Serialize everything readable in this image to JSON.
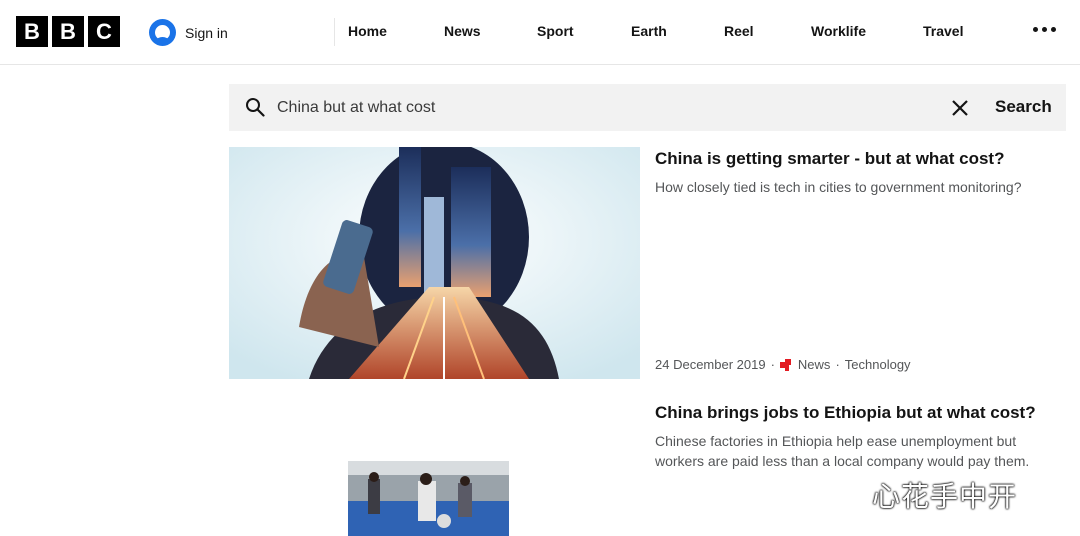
{
  "header": {
    "logo_letters": [
      "B",
      "B",
      "C"
    ],
    "signin_label": "Sign in",
    "nav": [
      "Home",
      "News",
      "Sport",
      "Earth",
      "Reel",
      "Worklife",
      "Travel"
    ],
    "more_icon": "more-horizontal-icon"
  },
  "search": {
    "value": "China but at what cost",
    "search_label": "Search",
    "search_icon": "search-icon",
    "clear_icon": "close-icon"
  },
  "results": [
    {
      "title": "China is getting smarter - but at what cost?",
      "summary": "How closely tied is tech in cities to government monitoring?",
      "date": "24 December 2019",
      "section": "News",
      "topic": "Technology",
      "separator": "·"
    },
    {
      "title": "China brings jobs to Ethiopia but at what cost?",
      "summary": "Chinese factories in Ethiopia help ease unemployment but workers are paid less than a local company would pay them."
    }
  ],
  "watermark": "心花手中开",
  "colors": {
    "accent_blue": "#1a73e8",
    "news_red": "#e31b23",
    "search_bg": "#f2f2f2",
    "muted_text": "#545658"
  }
}
